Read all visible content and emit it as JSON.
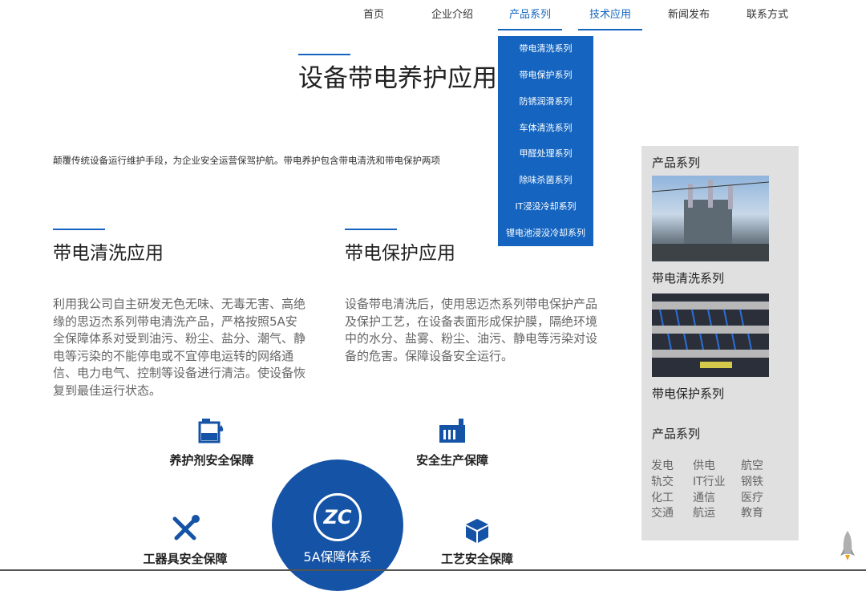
{
  "nav": [
    "首页",
    "企业介绍",
    "产品系列",
    "技术应用",
    "新闻发布",
    "联系方式"
  ],
  "dropdown": [
    "带电清洗系列",
    "带电保护系列",
    "防锈润滑系列",
    "车体清洗系列",
    "甲醛处理系列",
    "除味杀菌系列",
    "IT浸没冷却系列",
    "锂电池浸没冷却系列"
  ],
  "main": {
    "title": "设备带电养护应用",
    "intro": "颠覆传统设备运行维护手段，为企业安全运营保驾护航。带电养护包含带电清洗和带电保护两项",
    "clean": {
      "title": "带电清洗应用",
      "text": "利用我公司自主研发无色无味、无毒无害、高绝缘的思迈杰系列带电清洗产品，严格按照5A安全保障体系对受到油污、粉尘、盐分、潮气、静电等污染的不能停电或不宜停电运转的网络通信、电力电气、控制等设备进行清洁。使设备恢复到最佳运行状态。"
    },
    "protect": {
      "title": "带电保护应用",
      "text": "设备带电清洗后，使用思迈杰系列带电保护产品及保护工艺，在设备表面形成保护膜，隔绝环境中的水分、盐雾、粉尘、油污、静电等污染对设备的危害。保障设备安全运行。"
    }
  },
  "safety": {
    "agent": "养护剂安全保障",
    "production": "安全生产保障",
    "tools": "工器具安全保障",
    "process": "工艺安全保障",
    "logo": "ZC",
    "center": "5A保障体系"
  },
  "sidebar": {
    "title": "产品系列",
    "img1_caption": "带电清洗系列",
    "img2_caption": "带电保护系列",
    "title2": "产品系列",
    "industries": [
      "发电",
      "供电",
      "航空",
      "轨交",
      "IT行业",
      "钢铁",
      "化工",
      "通信",
      "医疗",
      "交通",
      "航运",
      "教育"
    ]
  },
  "colors": {
    "accent": "#1565c0",
    "sidebar_bg": "#e0e0e0"
  }
}
